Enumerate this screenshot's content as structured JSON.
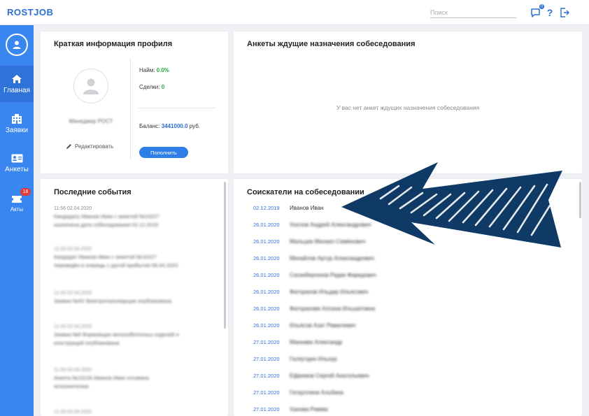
{
  "app": {
    "logo": "ROSTJOB"
  },
  "header": {
    "search_placeholder": "Поиск",
    "notif_count": "0"
  },
  "sidebar": {
    "items": [
      {
        "label": "Главная"
      },
      {
        "label": "Заявки"
      },
      {
        "label": "Анкеты"
      },
      {
        "label": "Акты",
        "badge": "18"
      }
    ]
  },
  "profile": {
    "title": "Краткая информация профиля",
    "name": "Менеджер РОСТ",
    "edit_label": "Редактировать",
    "hire_label": "Найм:",
    "hire_value": "0.0%",
    "deals_label": "Сделки:",
    "deals_value": "0",
    "balance_label": "Баланс:",
    "balance_value": "3441000.0",
    "balance_unit": "руб.",
    "topup_label": "Пополнить"
  },
  "pending": {
    "title": "Анкеты ждущие назначения собеседования",
    "empty_text": "У вас нет анкет ждущих назначения собеседования"
  },
  "events": {
    "title": "Последние события",
    "items": [
      {
        "time": "11:56 02.04.2020",
        "text1": "Кандидату Иванов Иван с анкетой №10227",
        "text2": "назначена дата собеседования 02.12.2019"
      },
      {
        "time": "11:33 02.04.2020",
        "text1": "Кандидат Иванов Иван с анкетой №10227",
        "text2": "переведён в очередь с датой прибытия 06.04.2020"
      },
      {
        "time": "11:33 02.04.2020",
        "text1": "Заявка №43 Электрогазосварщик опубликована",
        "text2": ""
      },
      {
        "time": "11:33 02.04.2020",
        "text1": "Заявка №8 Формовщик железобетонных изделий и",
        "text2": "конструкций опубликована"
      },
      {
        "time": "11:33 02.04.2020",
        "text1": "Анкета №10226 Иванов Иван отозвана",
        "text2": "исполнителем"
      },
      {
        "time": "11:33 02.04.2020",
        "text1": "",
        "text2": ""
      }
    ]
  },
  "candidates": {
    "title": "Соискатели на собеседовании",
    "rows": [
      {
        "date": "02.12.2019",
        "name": "Иванов Иван"
      },
      {
        "date": "26.01.2020",
        "name": "Хохлов Андрей Александрович"
      },
      {
        "date": "26.01.2020",
        "name": "Мальцев Михаил Семёнович"
      },
      {
        "date": "26.01.2020",
        "name": "Михайлов Артур Александрович"
      },
      {
        "date": "26.01.2020",
        "name": "Сагинбергенов Радик Фаридович"
      },
      {
        "date": "26.01.2020",
        "name": "Фатхрахов Ильдар Ильясович"
      },
      {
        "date": "26.01.2020",
        "name": "Фатхрахова Алсина Ильшатовна"
      },
      {
        "date": "26.01.2020",
        "name": "Ильясов Азат Рамилевич"
      },
      {
        "date": "27.01.2020",
        "name": "Маннава Александр"
      },
      {
        "date": "27.01.2020",
        "name": "Галяутдин Ильнур"
      },
      {
        "date": "27.01.2020",
        "name": "Ефремов Сергей Анатольевич"
      },
      {
        "date": "27.01.2020",
        "name": "Гатауллина Альбина"
      },
      {
        "date": "27.01.2020",
        "name": "Ханова Римма"
      }
    ]
  },
  "colors": {
    "accent": "#2b6fd6",
    "sidebar": "#3a86f0",
    "arrow": "#0f3a66",
    "badge": "#e53935",
    "positive": "#27ae3d"
  },
  "icons": [
    "user-icon",
    "home-icon",
    "building-icon",
    "id-card-icon",
    "ticket-icon",
    "chat-icon",
    "help-icon",
    "logout-icon",
    "pencil-icon",
    "arrow-icon"
  ]
}
